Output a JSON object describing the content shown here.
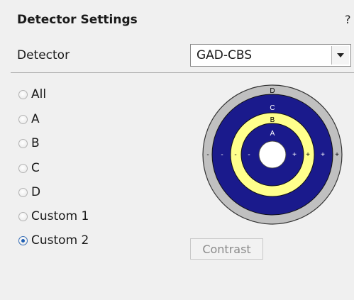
{
  "panel": {
    "title": "Detector Settings",
    "help": "?"
  },
  "detector": {
    "label": "Detector",
    "value": "GAD-CBS"
  },
  "radios": [
    {
      "label": "All",
      "checked": false
    },
    {
      "label": "A",
      "checked": false
    },
    {
      "label": "B",
      "checked": false
    },
    {
      "label": "C",
      "checked": false
    },
    {
      "label": "D",
      "checked": false
    },
    {
      "label": "Custom 1",
      "checked": false
    },
    {
      "label": "Custom 2",
      "checked": true
    }
  ],
  "diagram": {
    "segments": [
      "D",
      "C",
      "B",
      "A"
    ],
    "minus": "-",
    "plus": "+",
    "colors": {
      "outer": "#c0c0c0",
      "blue": "#1a1a8c",
      "yellow": "#ffff8c",
      "center": "#ffffff"
    }
  },
  "contrast_button": "Contrast"
}
